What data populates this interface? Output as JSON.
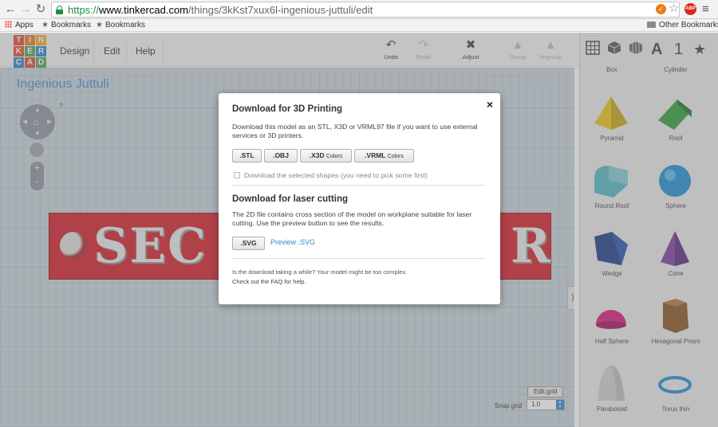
{
  "browser": {
    "url_scheme": "https://",
    "url_host": "www.tinkercad.com",
    "url_path": "/things/3kKst7xux6l-ingenious-juttuli/edit",
    "bookmarks": [
      "Apps",
      "Bookmarks",
      "Bookmarks"
    ],
    "other_bookmarks": "Other Bookmarks",
    "abp_label": "ABP"
  },
  "logo": {
    "letters": [
      "T",
      "I",
      "N",
      "K",
      "E",
      "R",
      "C",
      "A",
      "D"
    ],
    "colors": [
      "#e04b2f",
      "#e57a2a",
      "#f0a92c",
      "#e04b2f",
      "#4fa84f",
      "#2c84d4",
      "#2c84d4",
      "#e04b2f",
      "#4fa84f"
    ]
  },
  "menu": [
    "Design",
    "Edit",
    "Help"
  ],
  "toolbar": {
    "undo": "Undo",
    "redo": "Redo",
    "adjust": "Adjust",
    "group": "Group",
    "ungroup": "Ungroup"
  },
  "design": {
    "title": "Ingenious Juttuli",
    "help_q": "?",
    "zoom_in": "+",
    "zoom_out": "-",
    "keychain_text_left": "SEC",
    "keychain_text_right": "R",
    "edit_grid": "Edit grid",
    "snap_grid_label": "Snap grid",
    "snap_grid_value": "1.0",
    "collapse": "⟩"
  },
  "panel": {
    "top_icons": [
      "grid-icon",
      "box-icon",
      "cylinder-icon",
      "A",
      "1",
      "★"
    ],
    "headers": [
      "Box",
      "Cylinder"
    ],
    "shapes": [
      {
        "label": "Pyramid",
        "color": "#e8c619"
      },
      {
        "label": "Roof",
        "color": "#2f9e37"
      },
      {
        "label": "Round Roof",
        "color": "#54b6c4"
      },
      {
        "label": "Sphere",
        "color": "#1f8fd3"
      },
      {
        "label": "Wedge",
        "color": "#1f3d8c"
      },
      {
        "label": "Cone",
        "color": "#7a3fa2"
      },
      {
        "label": "Half Sphere",
        "color": "#d8197d"
      },
      {
        "label": "Hexagonal Prism",
        "color": "#8a5325"
      },
      {
        "label": "Paraboloid",
        "color": "#cfcfcf"
      },
      {
        "label": "Torus thin",
        "color": "#1e8fd0"
      }
    ]
  },
  "dialog": {
    "title_3d": "Download for 3D Printing",
    "desc_3d": "Download this model as an STL, X3D or VRML97 file if you want to use external services or 3D printers.",
    "btn_stl": ".STL",
    "btn_obj": ".OBJ",
    "btn_x3d": ".X3D",
    "btn_x3d_sub": "Colors",
    "btn_vrml": ".VRML",
    "btn_vrml_sub": "Colors",
    "selected_only": "Download the selected shapes (you need to pick some first)",
    "title_laser": "Download for laser cutting",
    "desc_laser": "The 2D file contains cross section of the model on workplane suitable for laser cutting. Use the preview button to see the results.",
    "btn_svg": ".SVG",
    "preview_svg": "Preview .SVG",
    "slow_note": "Is the download taking a while? Your model might be too complex.",
    "faq_link": "Check out the FAQ for help.",
    "close": "×"
  }
}
